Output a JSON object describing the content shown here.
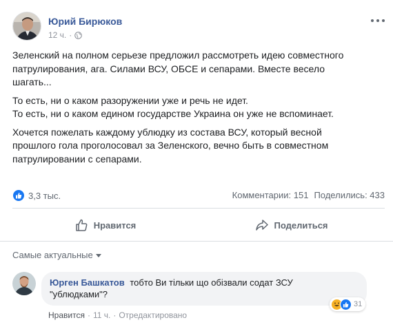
{
  "post": {
    "author": "Юрий Бирюков",
    "time": "12 ч.",
    "globe_icon": "globe-icon",
    "more_icon": "more-dots-icon",
    "paragraphs": [
      "Зеленский на полном серьезе предложил рассмотреть идею совместного патрулирования, ага. Силами ВСУ, ОБСЕ и сепарами. Вместе весело шагать...",
      "То есть, ни о каком разоружении уже и речь не идет. То есть, ни о каком едином государстве Украина он уже не вспоминает.",
      "Хочется пожелать каждому ублюдку из состава ВСУ, который весной прошлого гола проголосовал за Зеленского, вечно быть в совместном патрулировании с сепарами."
    ],
    "paragraph_lines": [
      [
        "Зеленский на полном серьезе предложил рассмотреть идею совместного",
        "патрулирования, ага. Силами ВСУ, ОБСЕ и сепарами. Вместе весело",
        "шагать..."
      ],
      [
        "То есть, ни о каком разоружении уже и речь не идет.",
        "То есть, ни о каком едином государстве Украина он уже не вспоминает."
      ],
      [
        "Хочется пожелать каждому ублюдку из состава ВСУ, который весной",
        "прошлого гола проголосовал за Зеленского, вечно быть в совместном",
        "патрулировании с сепарами."
      ]
    ]
  },
  "stats": {
    "likes": "3,3 тыс.",
    "comments": "Комментарии: 151",
    "shares": "Поделились: 433"
  },
  "actions": {
    "like": "Нравится",
    "share": "Поделиться"
  },
  "comments": {
    "sort_label": "Самые актуальные",
    "items": [
      {
        "author": "Юрген Башкатов",
        "text": "тобто Ви тільки що обізвали содат ЗСУ \"ублюдками\"?",
        "line1": "тобто Ви тільки що обізвали содат ЗСУ",
        "line2": "\"ублюдками\"?",
        "like_label": "Нравится",
        "sep": "·",
        "time": "11 ч.",
        "edited": "Отредактировано",
        "reactions_count": "31",
        "reaction_icons": [
          "haha-icon",
          "like-icon"
        ]
      }
    ]
  },
  "colors": {
    "link": "#385898",
    "like_blue": "#1877f2",
    "muted": "#606770",
    "bubble": "#f2f3f5"
  }
}
